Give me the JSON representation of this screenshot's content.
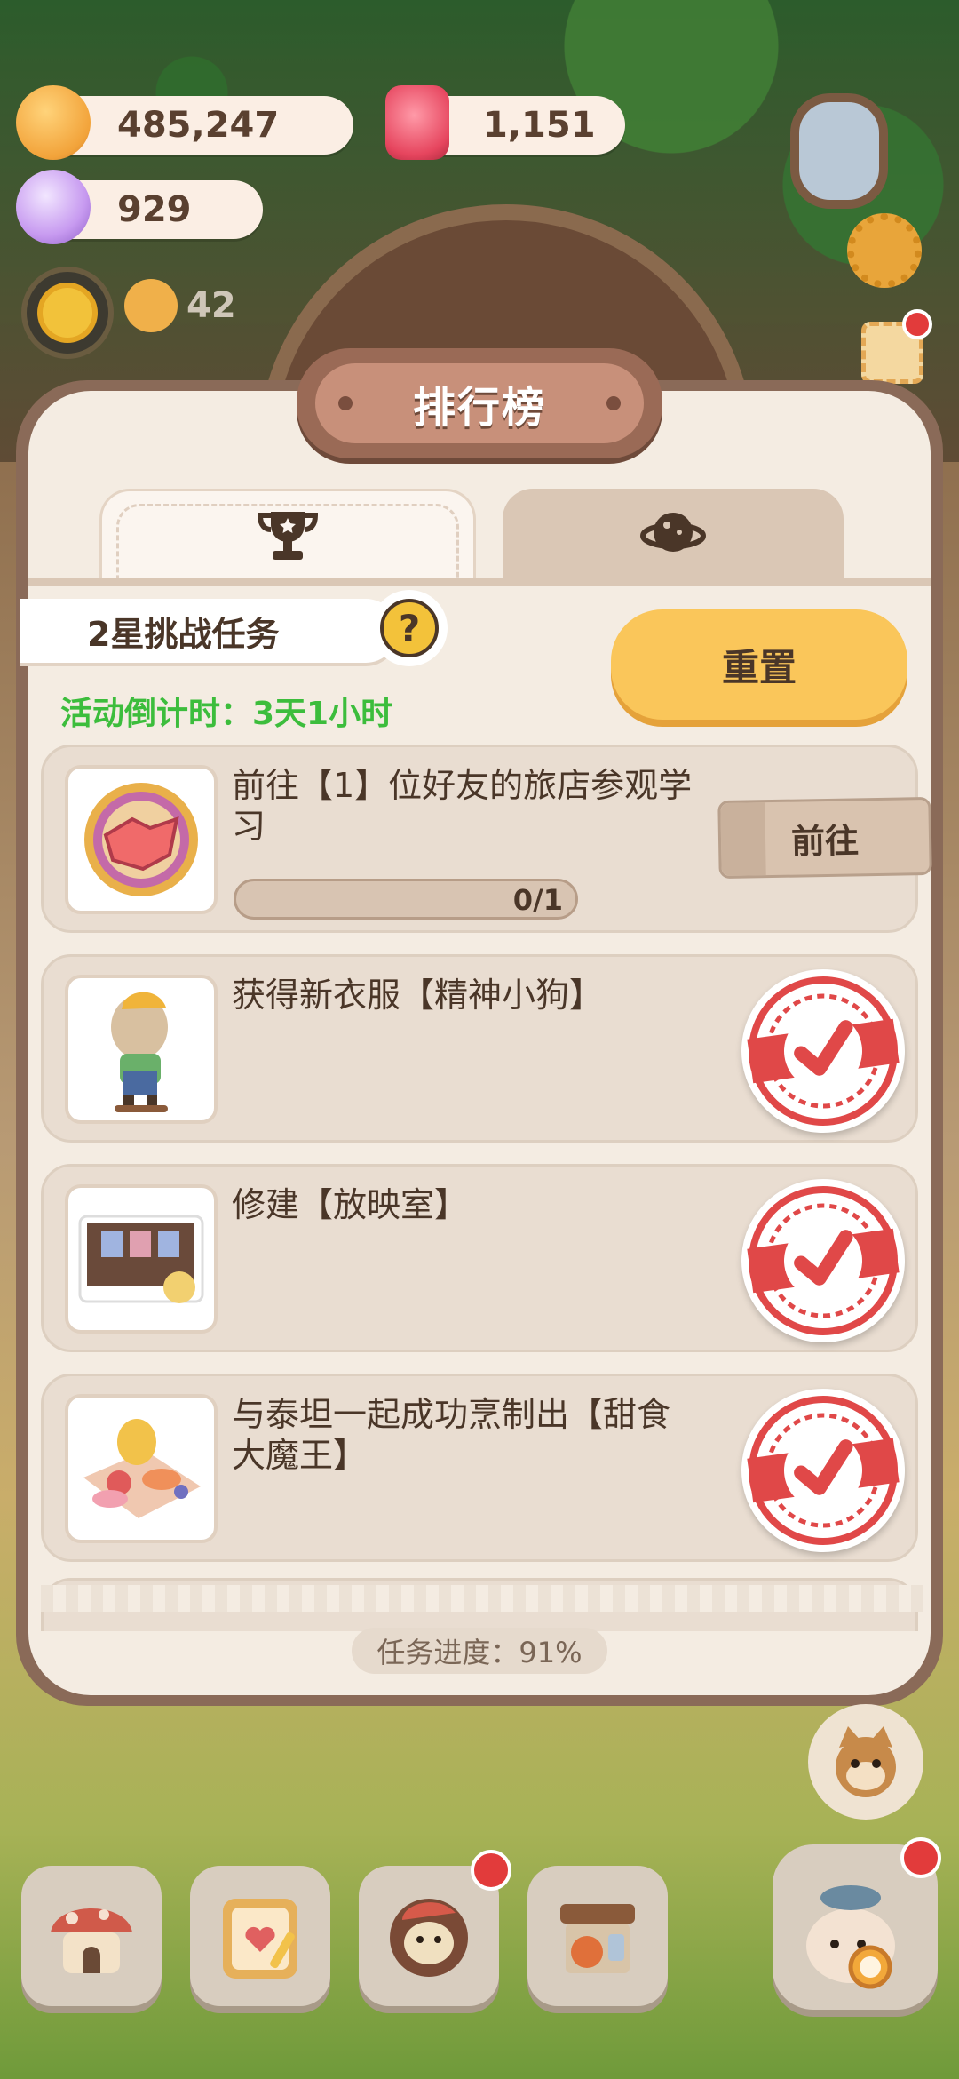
{
  "resources": {
    "cookies": "485,247",
    "candles": "1,151",
    "gems": "929"
  },
  "level": "42",
  "panel": {
    "title": "排行榜",
    "tabs": [
      {
        "icon": "trophy-icon",
        "active": true
      },
      {
        "icon": "planet-icon",
        "active": false
      }
    ],
    "challenge_label": "2星挑战任务",
    "help": "?",
    "countdown": "活动倒计时：3天1小时",
    "reset_label": "重置",
    "tasks": [
      {
        "text": "前往【1】位好友的旅店参观学习",
        "progress_text": "0/1",
        "progress": 0,
        "action": "前往",
        "done": false,
        "icon": "handshake-icon"
      },
      {
        "text": "获得新衣服【精神小狗】",
        "done": true,
        "icon": "outfit-icon"
      },
      {
        "text": "修建【放映室】",
        "done": true,
        "icon": "screening-room-icon"
      },
      {
        "text": "与泰坦一起成功烹制出【甜食大魔王】",
        "done": true,
        "icon": "dessert-icon"
      }
    ],
    "overall_progress": "任务进度：91%"
  },
  "colors": {
    "accent": "#fac65a",
    "countdown": "#3cbd3c",
    "stamp_red": "#e04848"
  },
  "bottom_bar": [
    "house-icon",
    "notebook-icon",
    "chef-icon",
    "shop-icon",
    "alarm-fish-icon"
  ]
}
